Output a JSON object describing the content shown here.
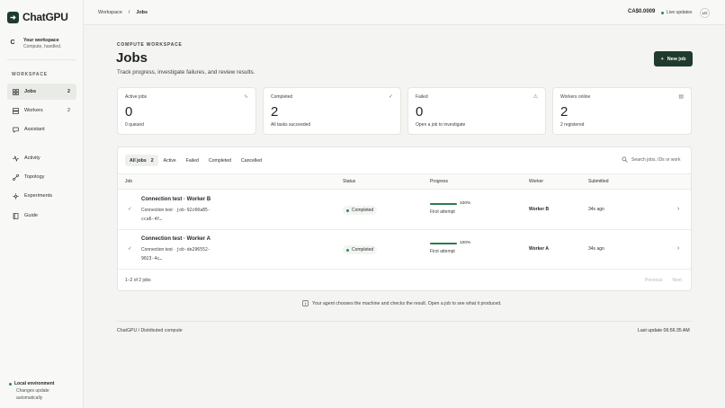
{
  "brand": {
    "mark": "➜",
    "name": "ChatGPU"
  },
  "workspace": {
    "avatar": "C",
    "title": "Your workspace",
    "subtitle": "Compute, handled."
  },
  "nav": {
    "heading": "WORKSPACE",
    "items": [
      {
        "label": "Jobs",
        "count": "2",
        "icon": "grid-icon"
      },
      {
        "label": "Workers",
        "count": "2",
        "icon": "server-icon"
      },
      {
        "label": "Assistant",
        "icon": "chat-icon"
      },
      {
        "label": "Activity",
        "icon": "activity-icon"
      },
      {
        "label": "Topology",
        "icon": "topology-icon"
      },
      {
        "label": "Experiments",
        "icon": "experiment-icon"
      },
      {
        "label": "Guide",
        "icon": "book-icon"
      }
    ]
  },
  "environment": {
    "title": "Local environment",
    "note": "Changes update automatically"
  },
  "topbar": {
    "breadcrumb": [
      "Workspace",
      "/",
      "Jobs"
    ],
    "cost": "CA$0.0009",
    "live": "Live updates",
    "user_initials": "LD"
  },
  "header": {
    "eyebrow": "COMPUTE WORKSPACE",
    "title": "Jobs",
    "subtitle": "Track progress, investigate failures, and review results.",
    "new_button": "New job"
  },
  "stats": [
    {
      "label": "Active jobs",
      "value": "0",
      "sub": "0 queued",
      "icon": "activity-icon"
    },
    {
      "label": "Completed",
      "value": "2",
      "sub": "All tasks succeeded",
      "icon": "check-icon"
    },
    {
      "label": "Failed",
      "value": "0",
      "sub": "Open a job to investigate",
      "icon": "warning-icon"
    },
    {
      "label": "Workers online",
      "value": "2",
      "sub": "2 registered",
      "icon": "server-icon"
    }
  ],
  "tabs": [
    {
      "label": "All jobs",
      "count": "2"
    },
    {
      "label": "Active"
    },
    {
      "label": "Failed"
    },
    {
      "label": "Completed"
    },
    {
      "label": "Cancelled"
    }
  ],
  "search": {
    "placeholder": "Search jobs, IDs or work"
  },
  "columns": [
    "Job",
    "Status",
    "Progress",
    "Worker",
    "Submitted"
  ],
  "jobs": [
    {
      "name": "Connection test · Worker B",
      "type": "Connection test",
      "sep": "·",
      "id": "job-92c60a85-cca6-4f…",
      "status": "Completed",
      "progress": 100,
      "progress_label": "100%",
      "attempt": "First attempt",
      "worker": "Worker B",
      "submitted": "34s ago"
    },
    {
      "name": "Connection test · Worker A",
      "type": "Connection test",
      "sep": "·",
      "id": "job-de296552-9023-4c…",
      "status": "Completed",
      "progress": 100,
      "progress_label": "100%",
      "attempt": "First attempt",
      "worker": "Worker A",
      "submitted": "34s ago"
    }
  ],
  "table_footer": {
    "range": "1–2 of 2 jobs",
    "prev": "Previous",
    "next": "Next"
  },
  "hint": "Your agent chooses the machine and checks the result. Open a job to see what it produced.",
  "footer": {
    "left": "ChatGPU / Distributed compute",
    "right": "Last update 06:56:35 AM"
  },
  "colors": {
    "accent": "#1f3b2e",
    "success": "#2e8a55"
  }
}
